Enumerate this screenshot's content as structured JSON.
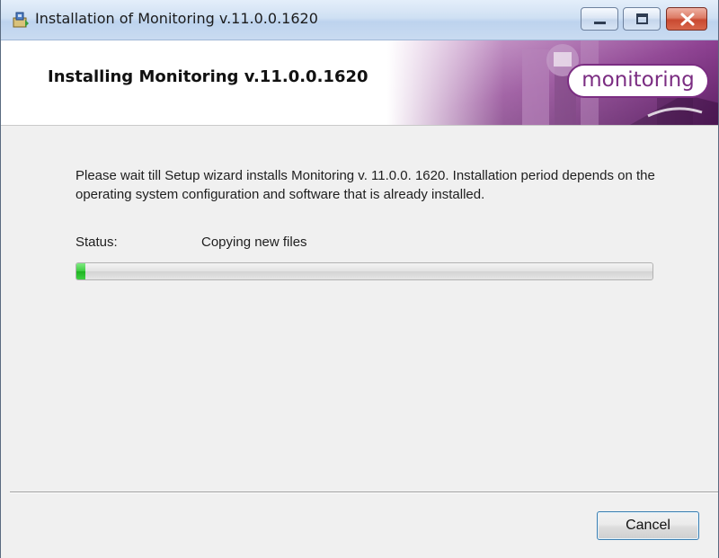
{
  "window": {
    "title": "Installation of Monitoring v.11.0.0.1620",
    "controls": {
      "minimize_icon": "minimize-icon",
      "maximize_icon": "maximize-icon",
      "close_icon": "close-icon"
    }
  },
  "header": {
    "heading": "Installing Monitoring v.11.0.0.1620",
    "logo_text": "monitoring",
    "accent_color": "#7b2d82"
  },
  "body": {
    "description": "Please wait till Setup wizard installs Monitoring v. 11.0.0. 1620. Installation period depends on the operating system configuration and software that is already installed.",
    "status_label": "Status:",
    "status_value": "Copying new files",
    "progress_fraction": 0.015
  },
  "footer": {
    "cancel_label": "Cancel"
  }
}
